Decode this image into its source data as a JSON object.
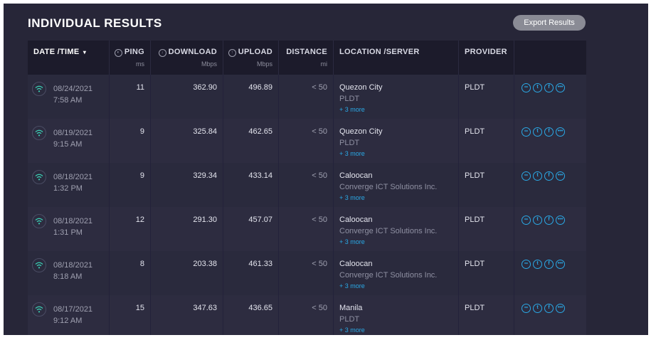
{
  "header": {
    "title": "INDIVIDUAL RESULTS",
    "export_label": "Export Results"
  },
  "columns": {
    "date": {
      "label": "DATE /TIME",
      "sort": "▾"
    },
    "ping": {
      "label": "PING",
      "unit": "ms"
    },
    "download": {
      "label": "DOWNLOAD",
      "unit": "Mbps"
    },
    "upload": {
      "label": "UPLOAD",
      "unit": "Mbps"
    },
    "distance": {
      "label": "DISTANCE",
      "unit": "mi"
    },
    "location": {
      "label": "LOCATION /SERVER"
    },
    "provider": {
      "label": "PROVIDER"
    }
  },
  "icons": {
    "status": "wifi-icon",
    "share": [
      "link-icon",
      "twitter-icon",
      "facebook-icon",
      "more-icon"
    ]
  },
  "colors": {
    "accent": "#2aa9e6",
    "wifi": "#3bd1b5"
  },
  "rows": [
    {
      "date": "08/24/2021",
      "time": "7:58 AM",
      "ping": "11",
      "download": "362.90",
      "upload": "496.89",
      "distance": "< 50",
      "location": "Quezon City",
      "server": "PLDT",
      "more": "+ 3 more",
      "provider": "PLDT"
    },
    {
      "date": "08/19/2021",
      "time": "9:15 AM",
      "ping": "9",
      "download": "325.84",
      "upload": "462.65",
      "distance": "< 50",
      "location": "Quezon City",
      "server": "PLDT",
      "more": "+ 3 more",
      "provider": "PLDT"
    },
    {
      "date": "08/18/2021",
      "time": "1:32 PM",
      "ping": "9",
      "download": "329.34",
      "upload": "433.14",
      "distance": "< 50",
      "location": "Caloocan",
      "server": "Converge ICT Solutions Inc.",
      "more": "+ 3 more",
      "provider": "PLDT"
    },
    {
      "date": "08/18/2021",
      "time": "1:31 PM",
      "ping": "12",
      "download": "291.30",
      "upload": "457.07",
      "distance": "< 50",
      "location": "Caloocan",
      "server": "Converge ICT Solutions Inc.",
      "more": "+ 3 more",
      "provider": "PLDT"
    },
    {
      "date": "08/18/2021",
      "time": "8:18 AM",
      "ping": "8",
      "download": "203.38",
      "upload": "461.33",
      "distance": "< 50",
      "location": "Caloocan",
      "server": "Converge ICT Solutions Inc.",
      "more": "+ 3 more",
      "provider": "PLDT"
    },
    {
      "date": "08/17/2021",
      "time": "9:12 AM",
      "ping": "15",
      "download": "347.63",
      "upload": "436.65",
      "distance": "< 50",
      "location": "Manila",
      "server": "PLDT",
      "more": "+ 3 more",
      "provider": "PLDT"
    }
  ]
}
